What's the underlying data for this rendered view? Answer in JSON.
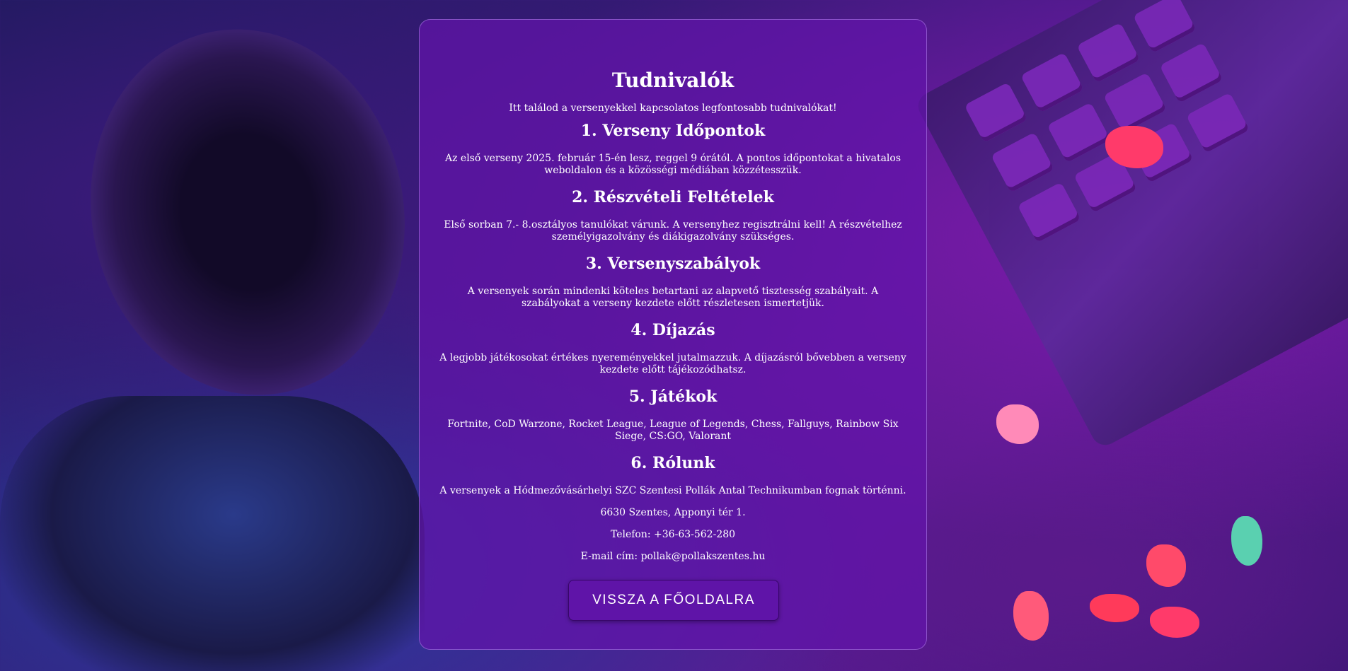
{
  "page": {
    "title": "Tudnivalók",
    "intro": "Itt találod a versenyekkel kapcsolatos legfontosabb tudnivalókat!"
  },
  "sections": [
    {
      "heading": "1. Verseny Időpontok",
      "text": "Az első verseny 2025. február 15-én lesz, reggel 9 órától. A pontos időpontokat a hivatalos weboldalon és a közösségi médiában közzétesszük."
    },
    {
      "heading": "2. Részvételi Feltételek",
      "text": "Első sorban 7.- 8.osztályos tanulókat várunk. A versenyhez regisztrálni kell! A részvételhez személyigazolvány és diákigazolvány szükséges."
    },
    {
      "heading": "3. Versenyszabályok",
      "text": "A versenyek során mindenki köteles betartani az alapvető tisztesség szabályait. A szabályokat a verseny kezdete előtt részletesen ismertetjük."
    },
    {
      "heading": "4. Díjazás",
      "text": "A legjobb játékosokat értékes nyereményekkel jutalmazzuk. A díjazásról bővebben a verseny kezdete előtt tájékozódhatsz."
    },
    {
      "heading": "5. Játékok",
      "text": "Fortnite, CoD Warzone, Rocket League, League of Legends, Chess, Fallguys, Rainbow Six Siege, CS:GO, Valorant"
    },
    {
      "heading": "6. Rólunk",
      "lines": [
        "A versenyek a Hódmezővásárhelyi SZC Szentesi Pollák Antal Technikumban fognak történni.",
        "6630 Szentes, Apponyi tér 1.",
        "Telefon: +36-63-562-280",
        "E-mail cím: pollak@pollakszentes.hu"
      ]
    }
  ],
  "back_button": {
    "label": "VISSZA A FŐOLDALRA"
  },
  "colors": {
    "card_bg": "#6214aa",
    "button_bg": "#5f14a8",
    "text": "#ffffff"
  }
}
